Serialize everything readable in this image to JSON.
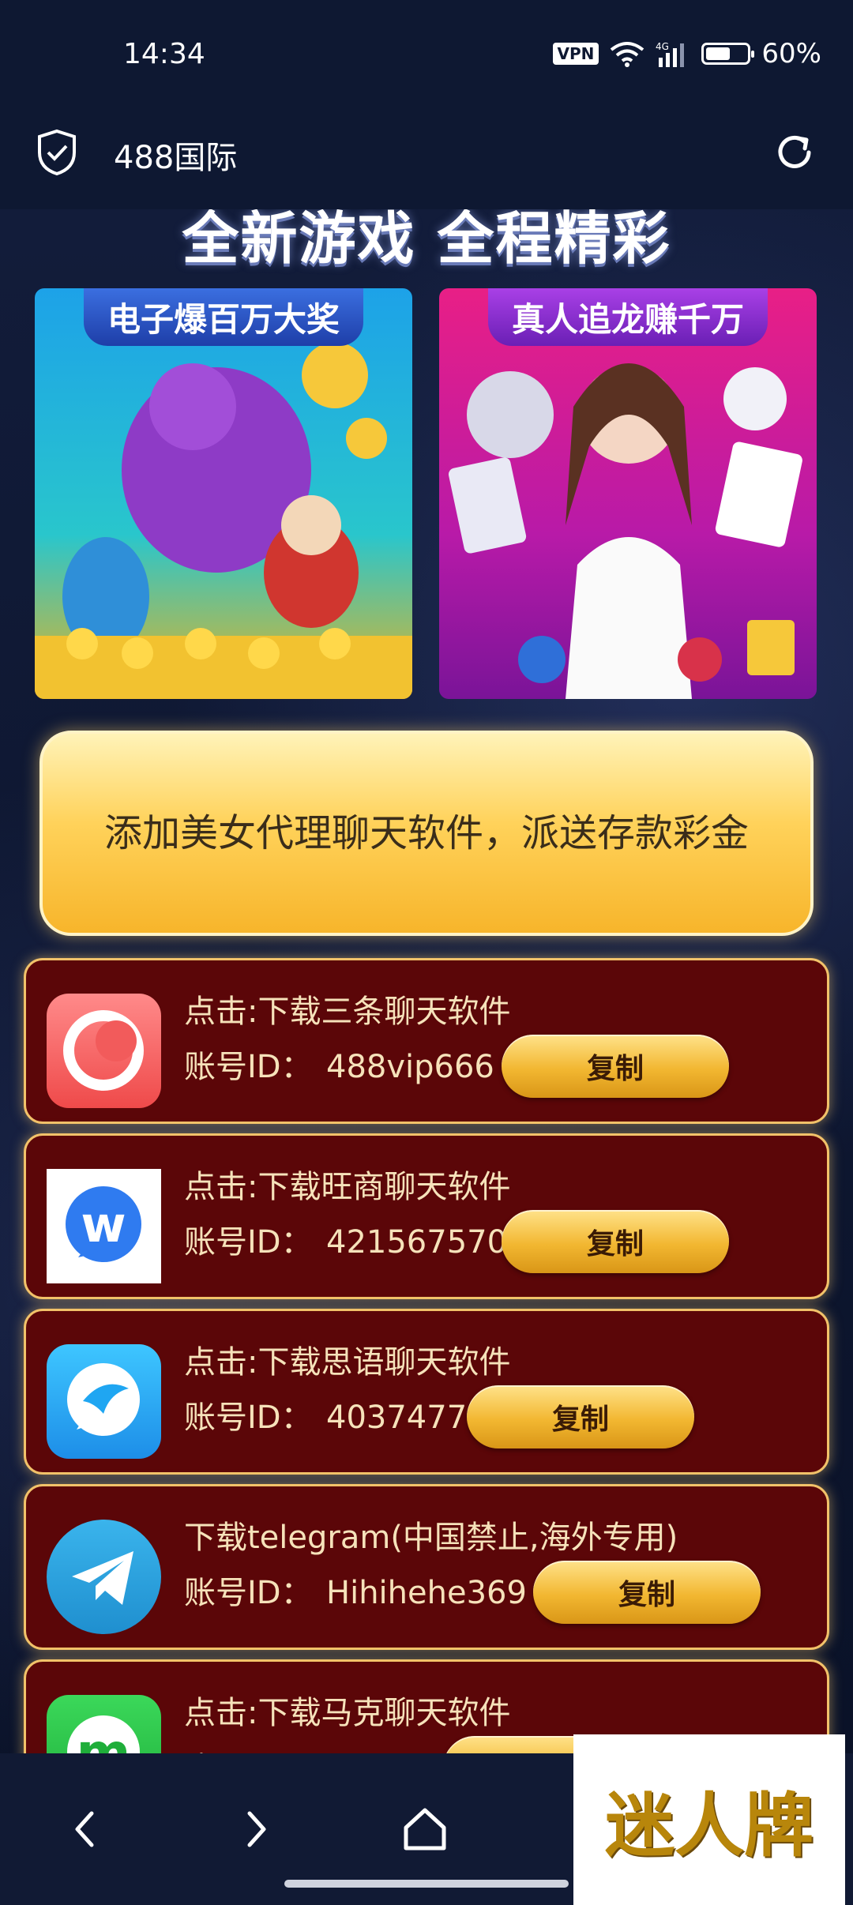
{
  "status_bar": {
    "time": "14:34",
    "vpn": "VPN",
    "network": "4G",
    "battery_text": "60%",
    "battery_level": 0.6
  },
  "toolbar": {
    "title": "488国际"
  },
  "banner": {
    "headline": "全新游戏 全程精彩",
    "promo_left": "电子爆百万大奖",
    "promo_right": "真人追龙赚千万"
  },
  "cta": {
    "text": "添加美女代理聊天软件，派送存款彩金"
  },
  "id_label": "账号ID：",
  "copy_label": "复制",
  "apps": [
    {
      "title": "点击:下载三条聊天软件",
      "account_id": "488vip666",
      "icon": "sancha-chat-icon",
      "color": "#f25b5b"
    },
    {
      "title": "点击:下载旺商聊天软件",
      "account_id": "421567570",
      "icon": "wangshang-chat-icon",
      "color": "#2f7bf0"
    },
    {
      "title": "点击:下载思语聊天软件",
      "account_id": "4037477",
      "icon": "siyu-chat-icon",
      "color": "#1fa6f2"
    },
    {
      "title": "下载telegram(中国禁止,海外专用)",
      "account_id": "Hihihehe369",
      "icon": "telegram-icon",
      "color": "#2aa3de"
    },
    {
      "title": "点击:下载马克聊天软件",
      "account_id": "",
      "icon": "make-chat-icon",
      "color": "#2fc94c"
    }
  ],
  "watermark": "迷人牌"
}
